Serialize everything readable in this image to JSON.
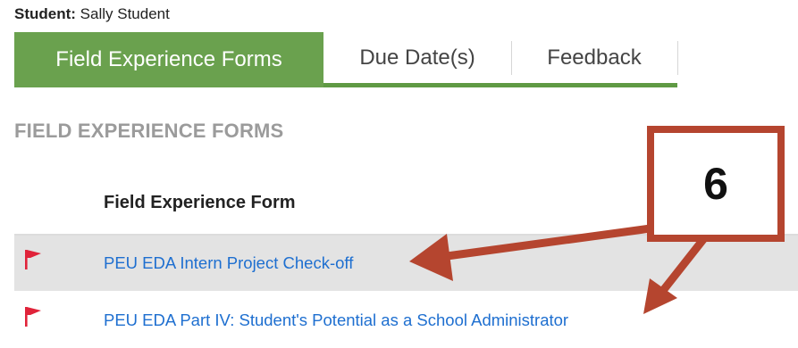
{
  "student": {
    "label": "Student:",
    "name": "Sally Student"
  },
  "tabs": [
    {
      "label": "Field Experience Forms",
      "active": true
    },
    {
      "label": "Due Date(s)",
      "active": false
    },
    {
      "label": "Feedback",
      "active": false
    }
  ],
  "section_title": "FIELD EXPERIENCE FORMS",
  "table": {
    "column_header": "Field Experience Form",
    "rows": [
      {
        "icon": "red-flag-icon",
        "link": "PEU EDA Intern Project Check-off"
      },
      {
        "icon": "red-flag-icon",
        "link": "PEU EDA Part IV: Student's Potential as a School Administrator"
      }
    ]
  },
  "callout": {
    "number": "6"
  },
  "colors": {
    "tab_active": "#6aa14e",
    "tab_underline": "#5f9a44",
    "link": "#1e6fd0",
    "flag": "#e0233a",
    "callout_border": "#b5452f",
    "arrow": "#b5452f"
  }
}
